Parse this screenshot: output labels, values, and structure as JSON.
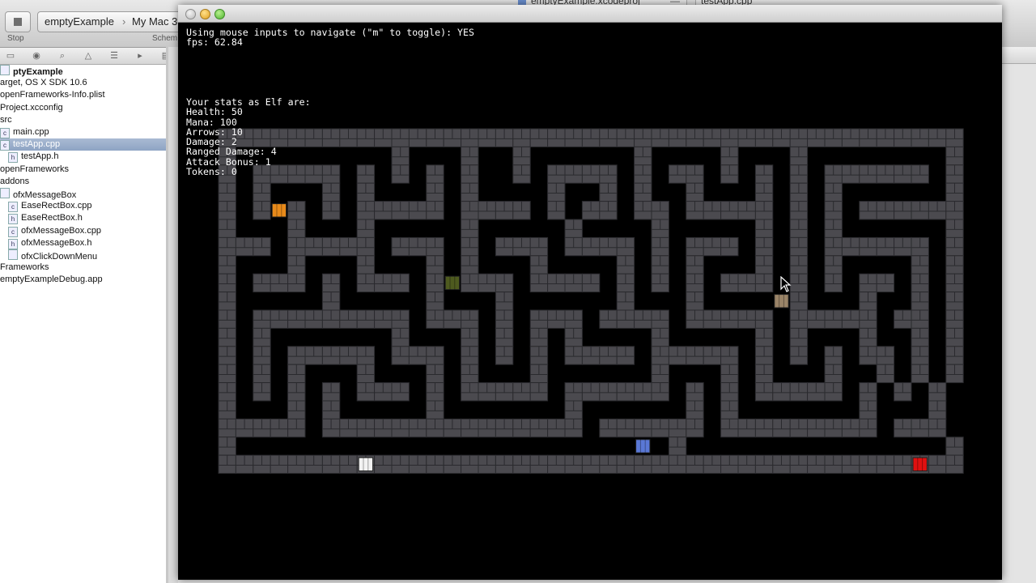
{
  "xcode": {
    "stop_label": "Stop",
    "scheme_name": "emptyExample",
    "scheme_sep": "›",
    "scheme_destination": "My Mac 3",
    "scheme_label": "Schem",
    "window_title_project": "emptyExample.xcodeproj",
    "window_title_dash": "—",
    "window_title_file": "testApp.cpp",
    "navigator": [
      {
        "label": "ptyExample",
        "icon": "project-icon",
        "bold": true
      },
      {
        "label": "arget, OS X SDK 10.6",
        "icon": ""
      },
      {
        "label": "openFrameworks-Info.plist",
        "icon": ""
      },
      {
        "label": "Project.xcconfig",
        "icon": ""
      },
      {
        "label": "src",
        "icon": ""
      },
      {
        "label": "main.cpp",
        "icon": "cpp-file-icon"
      },
      {
        "label": "testApp.cpp",
        "icon": "cpp-file-icon",
        "selected": true
      },
      {
        "label": "testApp.h",
        "icon": "h-file-icon"
      },
      {
        "label": "openFrameworks",
        "icon": ""
      },
      {
        "label": "addons",
        "icon": ""
      },
      {
        "label": "ofxMessageBox",
        "icon": "folder-icon"
      },
      {
        "label": "EaseRectBox.cpp",
        "icon": "cpp-file-icon"
      },
      {
        "label": "EaseRectBox.h",
        "icon": "h-file-icon"
      },
      {
        "label": "ofxMessageBox.cpp",
        "icon": "cpp-file-icon"
      },
      {
        "label": "ofxMessageBox.h",
        "icon": "h-file-icon"
      },
      {
        "label": "ofxClickDownMenu",
        "icon": "folder-icon"
      },
      {
        "label": "Frameworks",
        "icon": ""
      },
      {
        "label": "emptyExampleDebug.app",
        "icon": ""
      }
    ],
    "nav_icons": [
      "folder-icon",
      "symbol-icon",
      "search-icon",
      "warning-icon",
      "list-icon",
      "breakpoint-icon",
      "log-icon"
    ]
  },
  "game": {
    "mouse_mode_line": "Using mouse inputs to navigate (\"m\" to toggle): YES",
    "fps_line": "fps: 62.84",
    "stats_header": "Your stats as Elf are:",
    "stats": [
      "Health: 50",
      "Mana: 100",
      "Arrows: 10",
      "Damage: 2",
      "Ranged Damage: 4",
      "Attack Bonus: 1",
      "Tokens: 0"
    ],
    "colors": {
      "wall": "#4b4a4f",
      "wall_line": "#2a2a2e",
      "floor": "#000000",
      "player_elf": "#e88a1a",
      "enemy_green": "#4e5a1f",
      "enemy_tan": "#9a8468",
      "item_blue": "#5a78d6",
      "item_white": "#f2f2f2",
      "exit_red": "#e01010"
    },
    "maze": [
      "###########################################",
      "#.........#...#..#......#....#...#........#",
      "#.#####.#.#.#.#..#.####.#.##.#.#.#.######.#",
      "#.#...#.#...#.#....#..#.#..#...#.#.#......#",
      "#.#.#.#.#####.####.#.##.##.#####.#.#.######",
      "#...#...#.....#.....#....#.....#.#.#......#",
      "###.#####.###.#.###.####.#.###.#.#.######.#",
      "#...#...#...#.#...#....#.#.#...#.#.#....#.#",
      "#.###.#.###.#.###.####.#.#.#.###.#.#.##.#.#",
      "#.....#.....#...#......#...#.....#...#..#.#",
      "#.#########.###.#.###.####.#####.#####.##.#",
      "#.#.......#...#.#.#.#....#.....#.#...#..#.#",
      "#.#.#####.###.#.#.#.####.#####.#.#.#.##.#.#",
      "#.#.#...#...#.#...#......#...#.#...#..#.#.#",
      "#.#.#.#.###.#.#####.######.#.#.#####.#.#.#",
      "#...#.#.....#.......#......#.#.......#...#.",
      "#####.###############.######.#########.###",
      "#.........................#...............#",
      "###########################################"
    ],
    "entities": [
      {
        "name": "player-elf",
        "row": 4,
        "col": 3,
        "color_key": "player_elf"
      },
      {
        "name": "enemy-green",
        "row": 8,
        "col": 13,
        "color_key": "enemy_green"
      },
      {
        "name": "enemy-tan",
        "row": 9,
        "col": 32,
        "color_key": "enemy_tan"
      },
      {
        "name": "item-blue",
        "row": 17,
        "col": 24,
        "color_key": "item_blue"
      },
      {
        "name": "item-white",
        "row": 18,
        "col": 8,
        "color_key": "item_white"
      },
      {
        "name": "exit-red",
        "row": 18,
        "col": 40,
        "color_key": "exit_red"
      }
    ]
  }
}
